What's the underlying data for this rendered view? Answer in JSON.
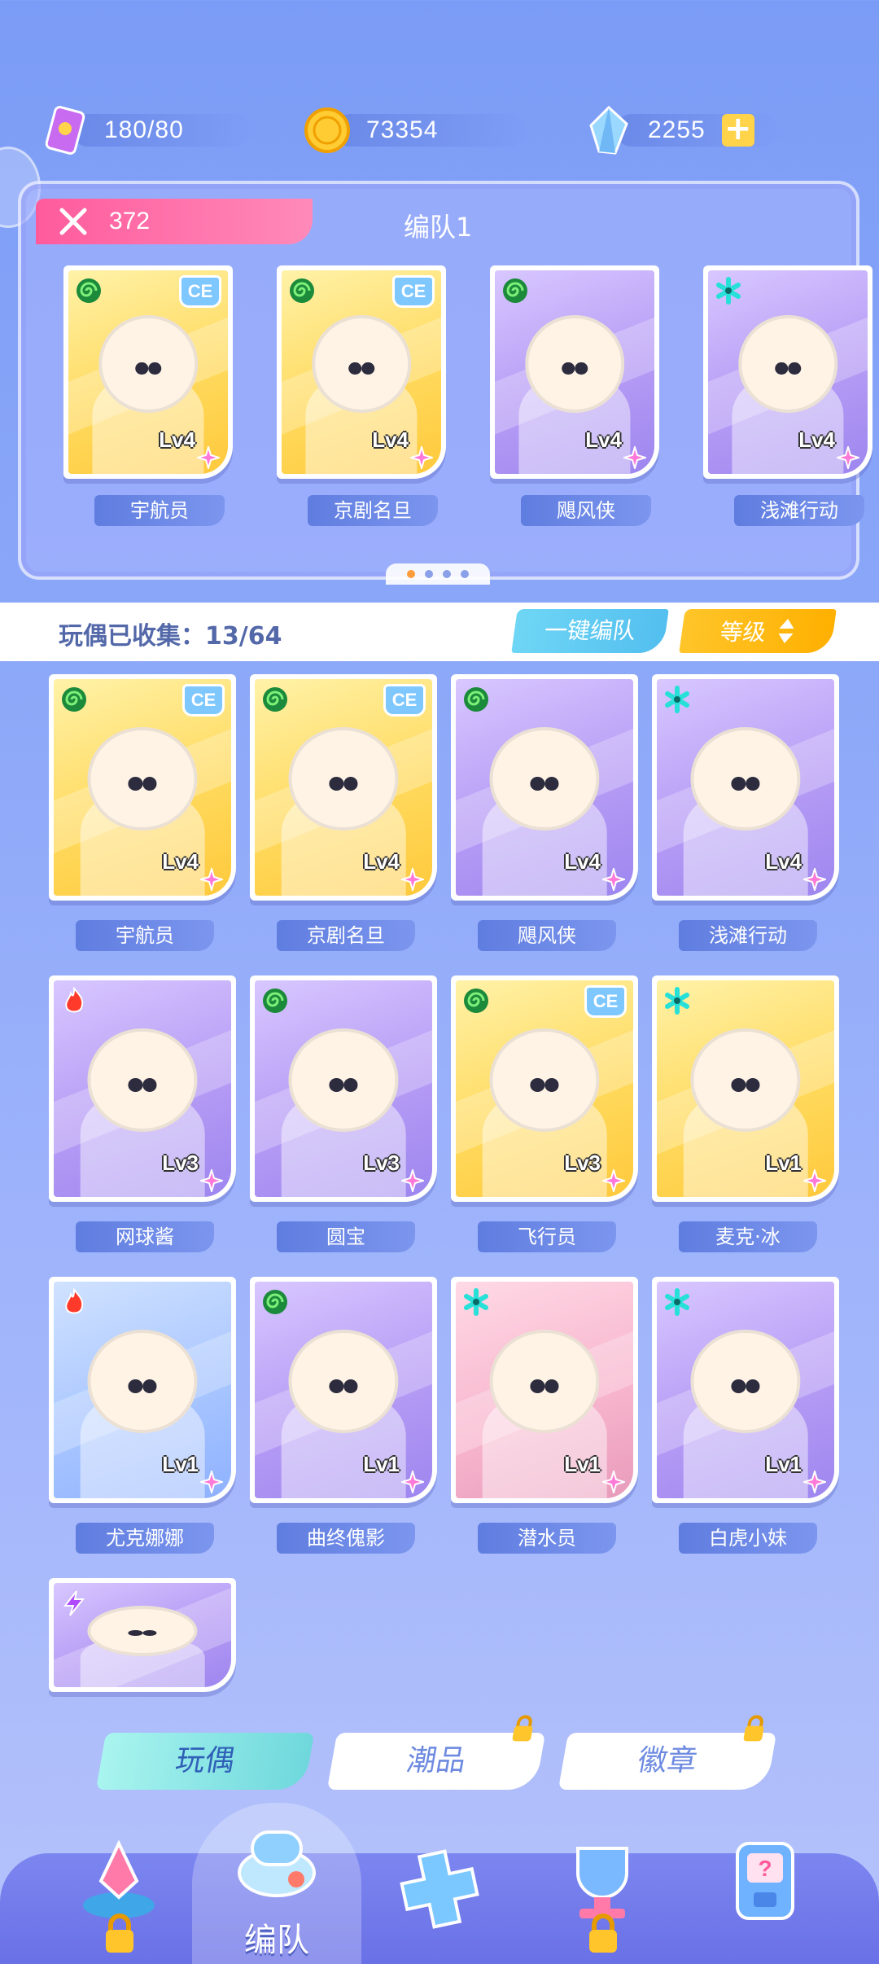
{
  "resources": {
    "stamina": "180/80",
    "coins": "73354",
    "gems": "2255",
    "plus": "+"
  },
  "team": {
    "power": "372",
    "name": "编队1",
    "members": [
      {
        "name": "宇航员",
        "level": "Lv4",
        "bg": "yellow",
        "type": "spiral",
        "ce": true
      },
      {
        "name": "京剧名旦",
        "level": "Lv4",
        "bg": "yellow",
        "type": "spiral",
        "ce": true
      },
      {
        "name": "飓风侠",
        "level": "Lv4",
        "bg": "purple",
        "type": "spiral",
        "ce": false
      },
      {
        "name": "浅滩行动",
        "level": "Lv4",
        "bg": "purple",
        "type": "asterisk",
        "ce": false
      }
    ],
    "page_dots": 4,
    "active_dot": 0
  },
  "collection": {
    "label": "玩偶已收集：13/64",
    "auto_team": "一键编队",
    "sort": "等级"
  },
  "dolls": [
    {
      "name": "宇航员",
      "level": "Lv4",
      "bg": "yellow",
      "type": "spiral",
      "ce": true
    },
    {
      "name": "京剧名旦",
      "level": "Lv4",
      "bg": "yellow",
      "type": "spiral",
      "ce": true
    },
    {
      "name": "飓风侠",
      "level": "Lv4",
      "bg": "purple",
      "type": "spiral",
      "ce": false
    },
    {
      "name": "浅滩行动",
      "level": "Lv4",
      "bg": "purple",
      "type": "asterisk",
      "ce": false
    },
    {
      "name": "网球酱",
      "level": "Lv3",
      "bg": "purple",
      "type": "fire",
      "ce": false
    },
    {
      "name": "圆宝",
      "level": "Lv3",
      "bg": "purple",
      "type": "spiral",
      "ce": false
    },
    {
      "name": "飞行员",
      "level": "Lv3",
      "bg": "yellow",
      "type": "spiral",
      "ce": true
    },
    {
      "name": "麦克·冰",
      "level": "Lv1",
      "bg": "yellow",
      "type": "asterisk",
      "ce": false
    },
    {
      "name": "尤克娜娜",
      "level": "Lv1",
      "bg": "blue",
      "type": "fire",
      "ce": false
    },
    {
      "name": "曲终傀影",
      "level": "Lv1",
      "bg": "purple",
      "type": "spiral",
      "ce": false
    },
    {
      "name": "潜水员",
      "level": "Lv1",
      "bg": "pink",
      "type": "asterisk",
      "ce": false
    },
    {
      "name": "白虎小妹",
      "level": "Lv1",
      "bg": "purple",
      "type": "asterisk",
      "ce": false
    },
    {
      "name": "",
      "level": "",
      "bg": "purple",
      "type": "bolt",
      "ce": false
    }
  ],
  "categories": [
    {
      "label": "玩偶",
      "active": true,
      "locked": false
    },
    {
      "label": "潮品",
      "active": false,
      "locked": true
    },
    {
      "label": "徽章",
      "active": false,
      "locked": true
    }
  ],
  "nav": {
    "center_label": "编队"
  },
  "colors": {
    "power_pink": "#ff5b9c",
    "auto_team_cyan": "#53bfef",
    "sort_yellow": "#ffb000",
    "active_tab": "#6fd8dc"
  }
}
